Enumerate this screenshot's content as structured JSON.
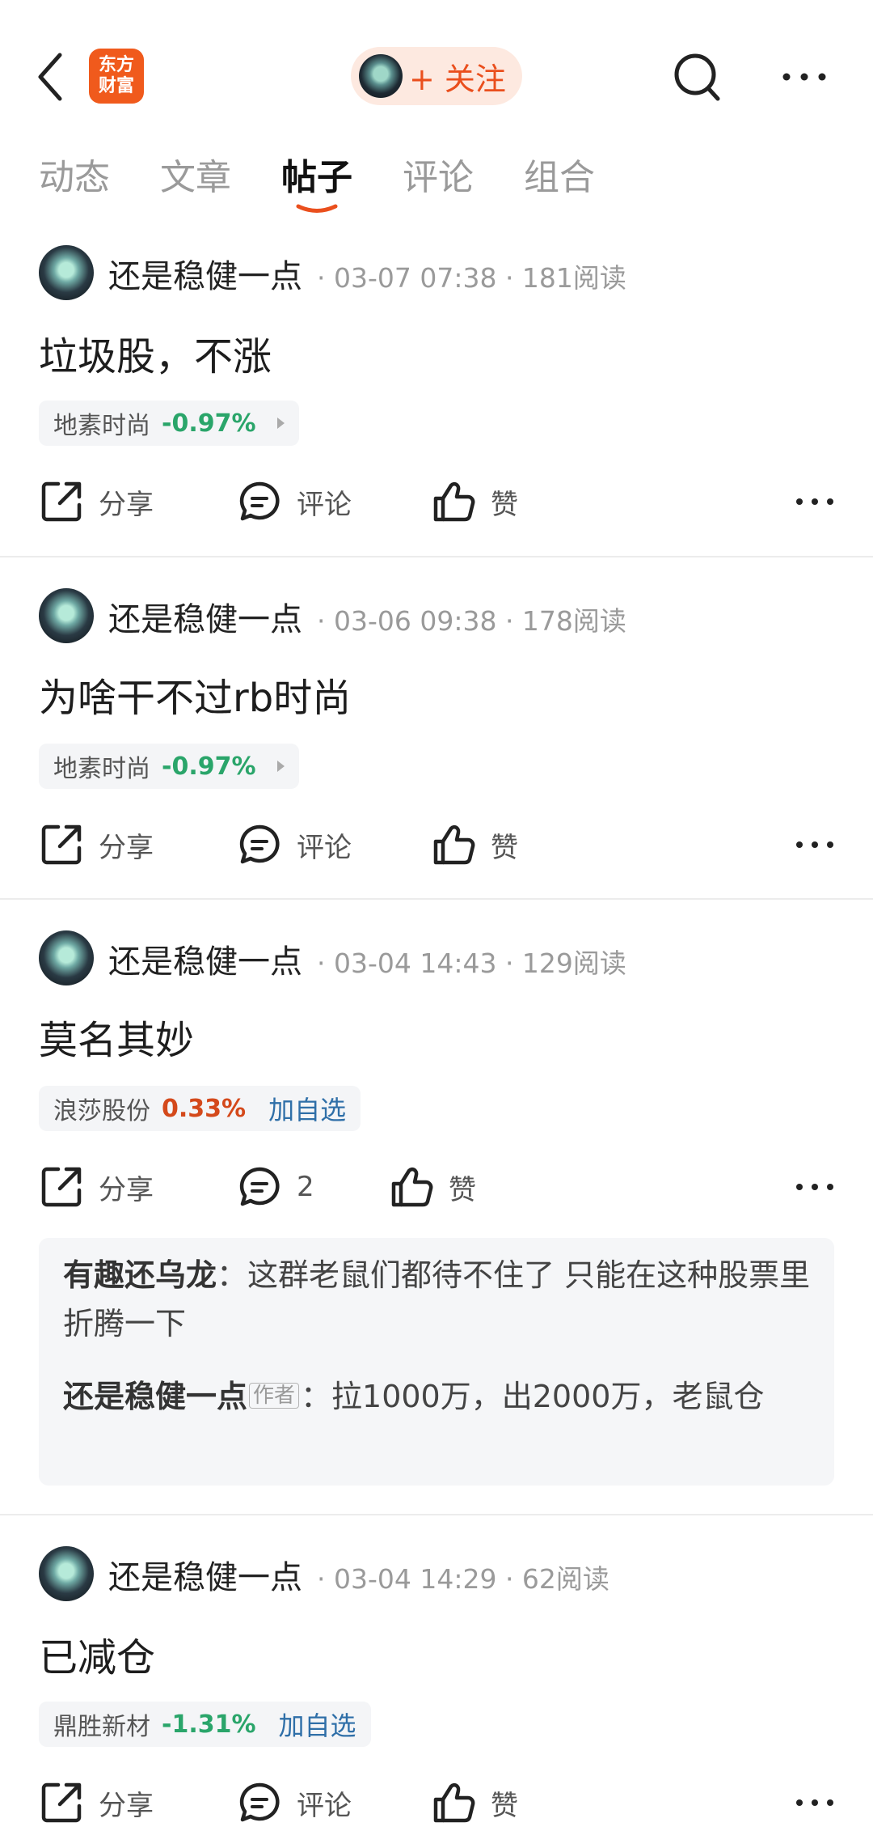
{
  "header": {
    "logo_line1": "东方",
    "logo_line2": "财富",
    "follow_label": "+ 关注"
  },
  "tabs": [
    {
      "label": "动态"
    },
    {
      "label": "文章"
    },
    {
      "label": "帖子",
      "active": true
    },
    {
      "label": "评论"
    },
    {
      "label": "组合"
    }
  ],
  "actions": {
    "share": "分享",
    "comment": "评论",
    "like": "赞"
  },
  "posts": [
    {
      "author": "还是稳健一点",
      "meta": "· 03-07 07:38 · 181阅读",
      "title": "垃圾股，不涨",
      "stock": {
        "name": "地素时尚",
        "change": "-0.97%"
      },
      "comment_label": "评论"
    },
    {
      "author": "还是稳健一点",
      "meta": "· 03-06 09:38 · 178阅读",
      "title": "为啥干不过rb时尚",
      "stock": {
        "name": "地素时尚",
        "change": "-0.97%"
      },
      "comment_label": "评论"
    },
    {
      "author": "还是稳健一点",
      "meta": "· 03-04 14:43 · 129阅读",
      "title": "莫名其妙",
      "stock": {
        "name": "浪莎股份",
        "change": "0.33%",
        "watch": "加自选"
      },
      "comment_label": "2",
      "comments": [
        {
          "author": "有趣还乌龙",
          "text": "：这群老鼠们都待不住了 只能在这种股票里折腾一下"
        },
        {
          "author": "还是稳健一点",
          "badge": "作者",
          "text": "：拉1000万，出2000万，老鼠仓"
        }
      ]
    },
    {
      "author": "还是稳健一点",
      "meta": "· 03-04 14:29 · 62阅读",
      "title": "已减仓",
      "stock": {
        "name": "鼎胜新材",
        "change": "-1.31%",
        "watch": "加自选"
      },
      "comment_label": "评论"
    }
  ],
  "colors": {
    "accent": "#ea4f1d",
    "down": "#2aa56a",
    "up": "#d4491b",
    "link": "#2f6fa8"
  }
}
